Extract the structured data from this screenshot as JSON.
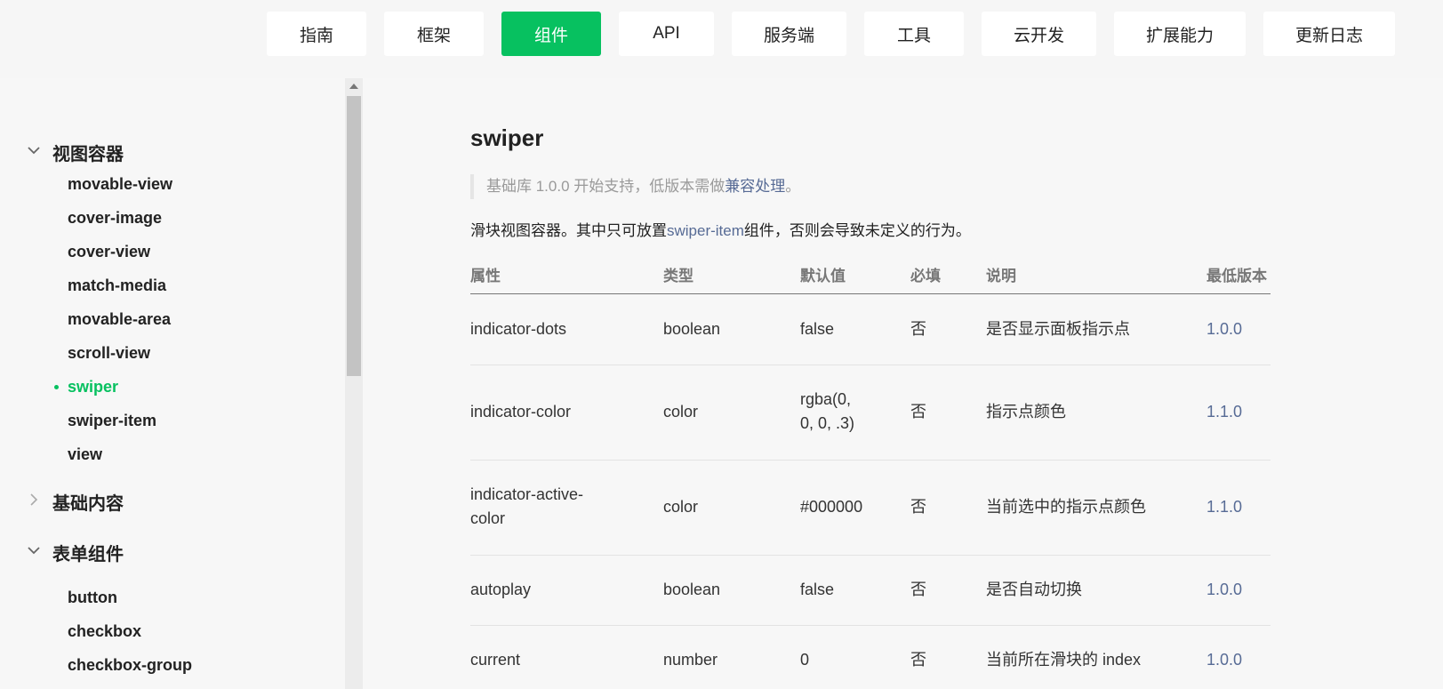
{
  "topnav": {
    "items": [
      {
        "label": "指南",
        "active": false
      },
      {
        "label": "框架",
        "active": false
      },
      {
        "label": "组件",
        "active": true
      },
      {
        "label": "API",
        "active": false
      },
      {
        "label": "服务端",
        "active": false
      },
      {
        "label": "工具",
        "active": false
      },
      {
        "label": "云开发",
        "active": false
      },
      {
        "label": "扩展能力",
        "active": false
      },
      {
        "label": "更新日志",
        "active": false
      }
    ]
  },
  "sidebar": {
    "groups": [
      {
        "label": "视图容器",
        "expanded": true,
        "items": [
          "movable-view",
          "cover-image",
          "cover-view",
          "match-media",
          "movable-area",
          "scroll-view",
          "swiper",
          "swiper-item",
          "view"
        ],
        "active_item": "swiper"
      },
      {
        "label": "基础内容",
        "expanded": false,
        "items": []
      },
      {
        "label": "表单组件",
        "expanded": true,
        "items": [
          "button",
          "checkbox",
          "checkbox-group"
        ]
      }
    ]
  },
  "main": {
    "title": "swiper",
    "support_note": {
      "prefix": "基础库 1.0.0 开始支持，低版本需做",
      "link": "兼容处理",
      "suffix": "。"
    },
    "description": {
      "prefix": "滑块视图容器。其中只可放置",
      "link": "swiper-item",
      "suffix": "组件，否则会导致未定义的行为。"
    },
    "table": {
      "headers": [
        "属性",
        "类型",
        "默认值",
        "必填",
        "说明",
        "最低版本"
      ],
      "rows": [
        {
          "attr": [
            "indicator-dots"
          ],
          "type": "boolean",
          "default": [
            "false"
          ],
          "required": "否",
          "desc": "是否显示面板指示点",
          "version": "1.0.0"
        },
        {
          "attr": [
            "indicator-color"
          ],
          "type": "color",
          "default": [
            "rgba(0,",
            "0, 0, .3)"
          ],
          "required": "否",
          "desc": "指示点颜色",
          "version": "1.1.0"
        },
        {
          "attr": [
            "indicator-active-",
            "color"
          ],
          "type": "color",
          "default": [
            "#000000"
          ],
          "required": "否",
          "desc": "当前选中的指示点颜色",
          "version": "1.1.0"
        },
        {
          "attr": [
            "autoplay"
          ],
          "type": "boolean",
          "default": [
            "false"
          ],
          "required": "否",
          "desc": "是否自动切换",
          "version": "1.0.0"
        },
        {
          "attr": [
            "current"
          ],
          "type": "number",
          "default": [
            "0"
          ],
          "required": "否",
          "desc": "当前所在滑块的 index",
          "version": "1.0.0"
        }
      ]
    }
  },
  "colors": {
    "accent": "#07c160",
    "link": "#576b95",
    "muted": "#9a9a9a"
  }
}
